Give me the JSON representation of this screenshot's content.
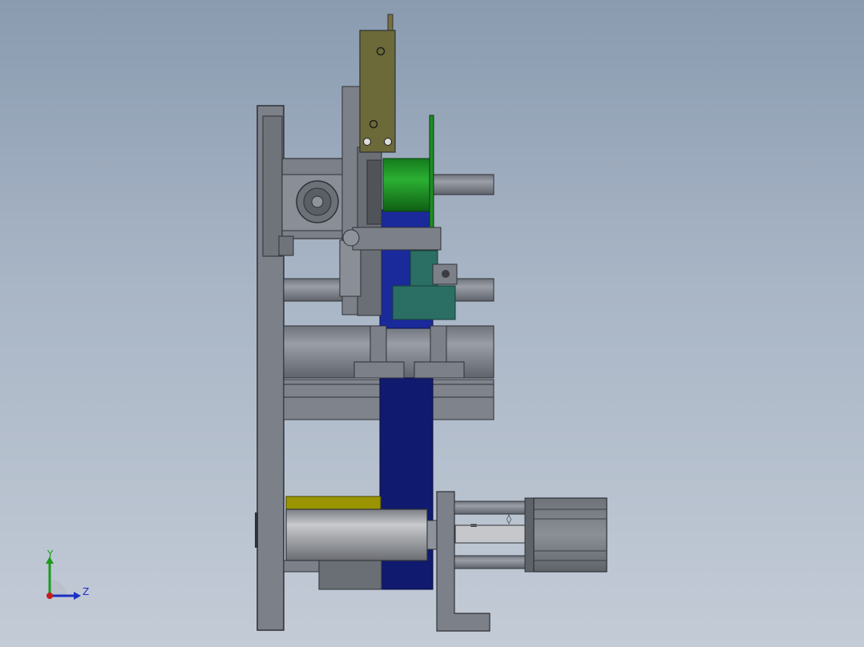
{
  "viewport": {
    "background_top": "#8a9bb0",
    "background_bottom": "#c3cbd6"
  },
  "colors": {
    "frame_gray": "#7c8088",
    "frame_dark": "#3c3f45",
    "cylinder_gray": "#8d9199",
    "olive_bracket": "#6b6a38",
    "green_wheel": "#1f8c25",
    "navy_belt": "#101a6e",
    "blue_belt": "#1a2a9a",
    "teal_block": "#2b6e63",
    "motor_gray": "#7d8289",
    "yellow_part": "#9a9400"
  },
  "triad": {
    "y_label": "Y",
    "z_label": "Z",
    "y_color": "#1c9b1c",
    "z_color": "#1d2fc4",
    "x_color": "#c41d1d"
  },
  "parts": [
    "vertical-frame-plate",
    "top-olive-bracket",
    "green-pulley",
    "navy-belt",
    "teal-mount-block",
    "upper-guide-rod",
    "middle-guide-rod",
    "lower-cylinder",
    "servo-motor",
    "roller-cylinder",
    "bearing-housing"
  ]
}
